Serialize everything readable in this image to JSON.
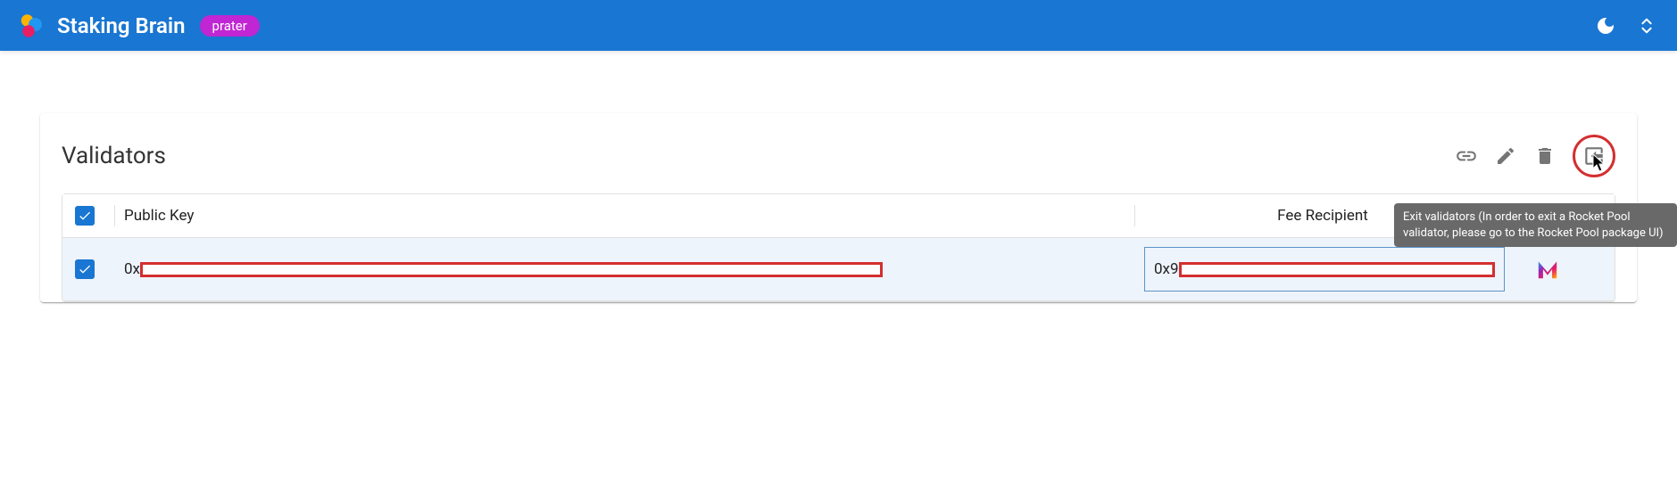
{
  "header": {
    "title": "Staking Brain",
    "network_chip": "prater"
  },
  "card": {
    "title": "Validators",
    "columns": {
      "pubkey": "Public Key",
      "fee": "Fee Recipient"
    },
    "rows": [
      {
        "pubkey_prefix": "0x",
        "fee_prefix": "0x9"
      }
    ]
  },
  "tooltip": {
    "exit": "Exit validators (In order to exit a Rocket Pool validator, please go to the Rocket Pool package UI)"
  }
}
